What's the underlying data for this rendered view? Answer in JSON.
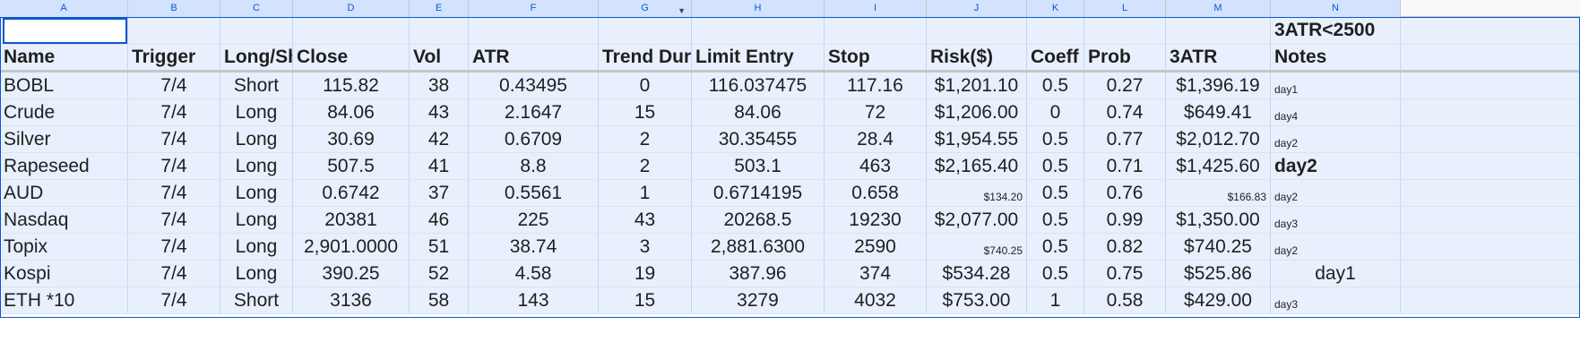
{
  "column_letters": [
    "A",
    "B",
    "C",
    "D",
    "E",
    "F",
    "G",
    "H",
    "I",
    "J",
    "K",
    "L",
    "M",
    "N"
  ],
  "header_note": "3ATR<2500",
  "headers": [
    "Name",
    "Trigger",
    "Long/Sh",
    "Close",
    "Vol",
    "ATR",
    "Trend Dur",
    "Limit Entry",
    "Stop",
    "Risk($)",
    "Coeff",
    "Prob",
    "3ATR",
    "Notes"
  ],
  "rows": [
    {
      "name": "BOBL",
      "trigger": "7/4",
      "side": "Short",
      "close": "115.82",
      "vol": "38",
      "atr": "0.43495",
      "trend": "0",
      "entry": "116.037475",
      "stop": "117.16",
      "risk": "$1,201.10",
      "coeff": "0.5",
      "prob": "0.27",
      "atr3": "$1,396.19",
      "notes": "day1"
    },
    {
      "name": "Crude",
      "trigger": "7/4",
      "side": "Long",
      "close": "84.06",
      "vol": "43",
      "atr": "2.1647",
      "trend": "15",
      "entry": "84.06",
      "stop": "72",
      "risk": "$1,206.00",
      "coeff": "0",
      "prob": "0.74",
      "atr3": "$649.41",
      "notes": "day4"
    },
    {
      "name": "Silver",
      "trigger": "7/4",
      "side": "Long",
      "close": "30.69",
      "vol": "42",
      "atr": "0.6709",
      "trend": "2",
      "entry": "30.35455",
      "stop": "28.4",
      "risk": "$1,954.55",
      "coeff": "0.5",
      "prob": "0.77",
      "atr3": "$2,012.70",
      "notes": "day2"
    },
    {
      "name": "Rapeseed",
      "trigger": "7/4",
      "side": "Long",
      "close": "507.5",
      "vol": "41",
      "atr": "8.8",
      "trend": "2",
      "entry": "503.1",
      "stop": "463",
      "risk": "$2,165.40",
      "coeff": "0.5",
      "prob": "0.71",
      "atr3": "$1,425.60",
      "notes": "day2"
    },
    {
      "name": "AUD",
      "trigger": "7/4",
      "side": "Long",
      "close": "0.6742",
      "vol": "37",
      "atr": "0.5561",
      "trend": "1",
      "entry": "0.6714195",
      "stop": "0.658",
      "risk": "$134.20",
      "coeff": "0.5",
      "prob": "0.76",
      "atr3": "$166.83",
      "notes": "day2"
    },
    {
      "name": "Nasdaq",
      "trigger": "7/4",
      "side": "Long",
      "close": "20381",
      "vol": "46",
      "atr": "225",
      "trend": "43",
      "entry": "20268.5",
      "stop": "19230",
      "risk": "$2,077.00",
      "coeff": "0.5",
      "prob": "0.99",
      "atr3": "$1,350.00",
      "notes": "day3"
    },
    {
      "name": "Topix",
      "trigger": "7/4",
      "side": "Long",
      "close": "2,901.0000",
      "vol": "51",
      "atr": "38.74",
      "trend": "3",
      "entry": "2,881.6300",
      "stop": "2590",
      "risk": "$740.25",
      "coeff": "0.5",
      "prob": "0.82",
      "atr3": "$740.25",
      "notes": "day2"
    },
    {
      "name": "Kospi",
      "trigger": "7/4",
      "side": "Long",
      "close": "390.25",
      "vol": "52",
      "atr": "4.58",
      "trend": "19",
      "entry": "387.96",
      "stop": "374",
      "risk": "$534.28",
      "coeff": "0.5",
      "prob": "0.75",
      "atr3": "$525.86",
      "notes": "day1"
    },
    {
      "name": "ETH *10",
      "trigger": "7/4",
      "side": "Short",
      "close": "3136",
      "vol": "58",
      "atr": "143",
      "trend": "15",
      "entry": "3279",
      "stop": "4032",
      "risk": "$753.00",
      "coeff": "1",
      "prob": "0.58",
      "atr3": "$429.00",
      "notes": "day3"
    }
  ]
}
